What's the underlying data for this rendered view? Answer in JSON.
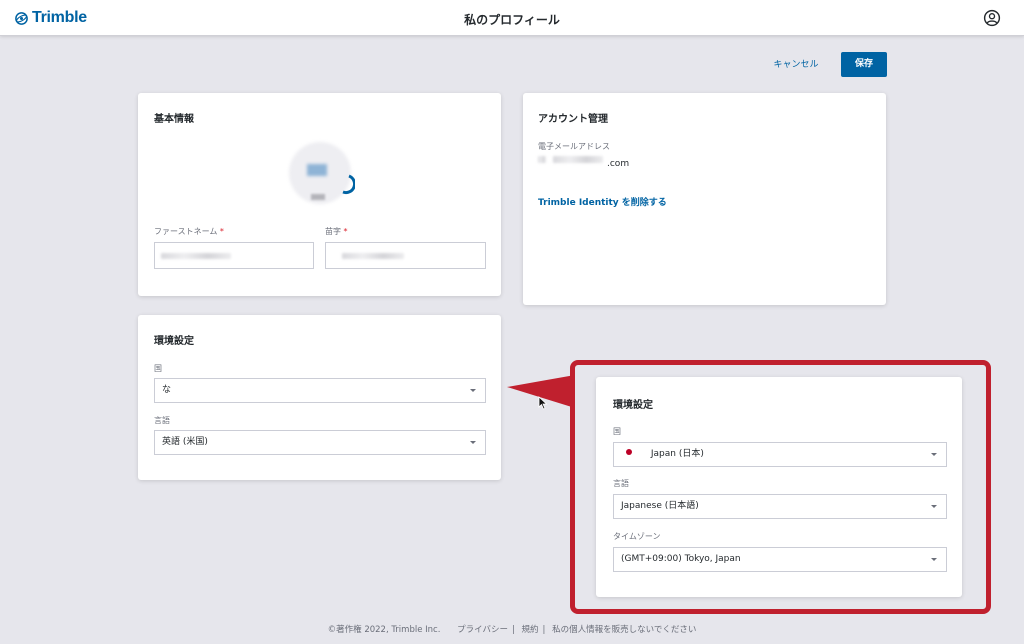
{
  "header": {
    "logo_text": "Trimble",
    "title": "私のプロフィール",
    "profile_icon": "user-circle-icon"
  },
  "actions": {
    "cancel_label": "キャンセル",
    "save_label": "保存",
    "accent_color": "#0063a3"
  },
  "basic_info": {
    "title": "基本情報",
    "first_name_label": "ファーストネーム",
    "last_name_label": "苗字",
    "required_mark": "*"
  },
  "account": {
    "title": "アカウント管理",
    "email_label": "電子メールアドレス",
    "email_suffix": ".com",
    "delete_link": "Trimble Identity を削除する"
  },
  "preferences_left": {
    "title": "環境設定",
    "country_label": "国",
    "country_value": "な",
    "language_label": "言語",
    "language_value": "英語 (米国)"
  },
  "preferences_zoom": {
    "title": "環境設定",
    "country_label": "国",
    "country_value": "Japan (日本)",
    "language_label": "言語",
    "language_value": "Japanese (日本語)",
    "timezone_label": "タイムゾーン",
    "timezone_value": "(GMT+09:00) Tokyo, Japan",
    "highlight_color": "#c0202e"
  },
  "footer": {
    "copyright": "©著作権 2022, Trimble Inc.",
    "privacy": "プライバシー",
    "terms": "規約",
    "do_not_sell": "私の個人情報を販売しないでください",
    "sep": "|"
  }
}
